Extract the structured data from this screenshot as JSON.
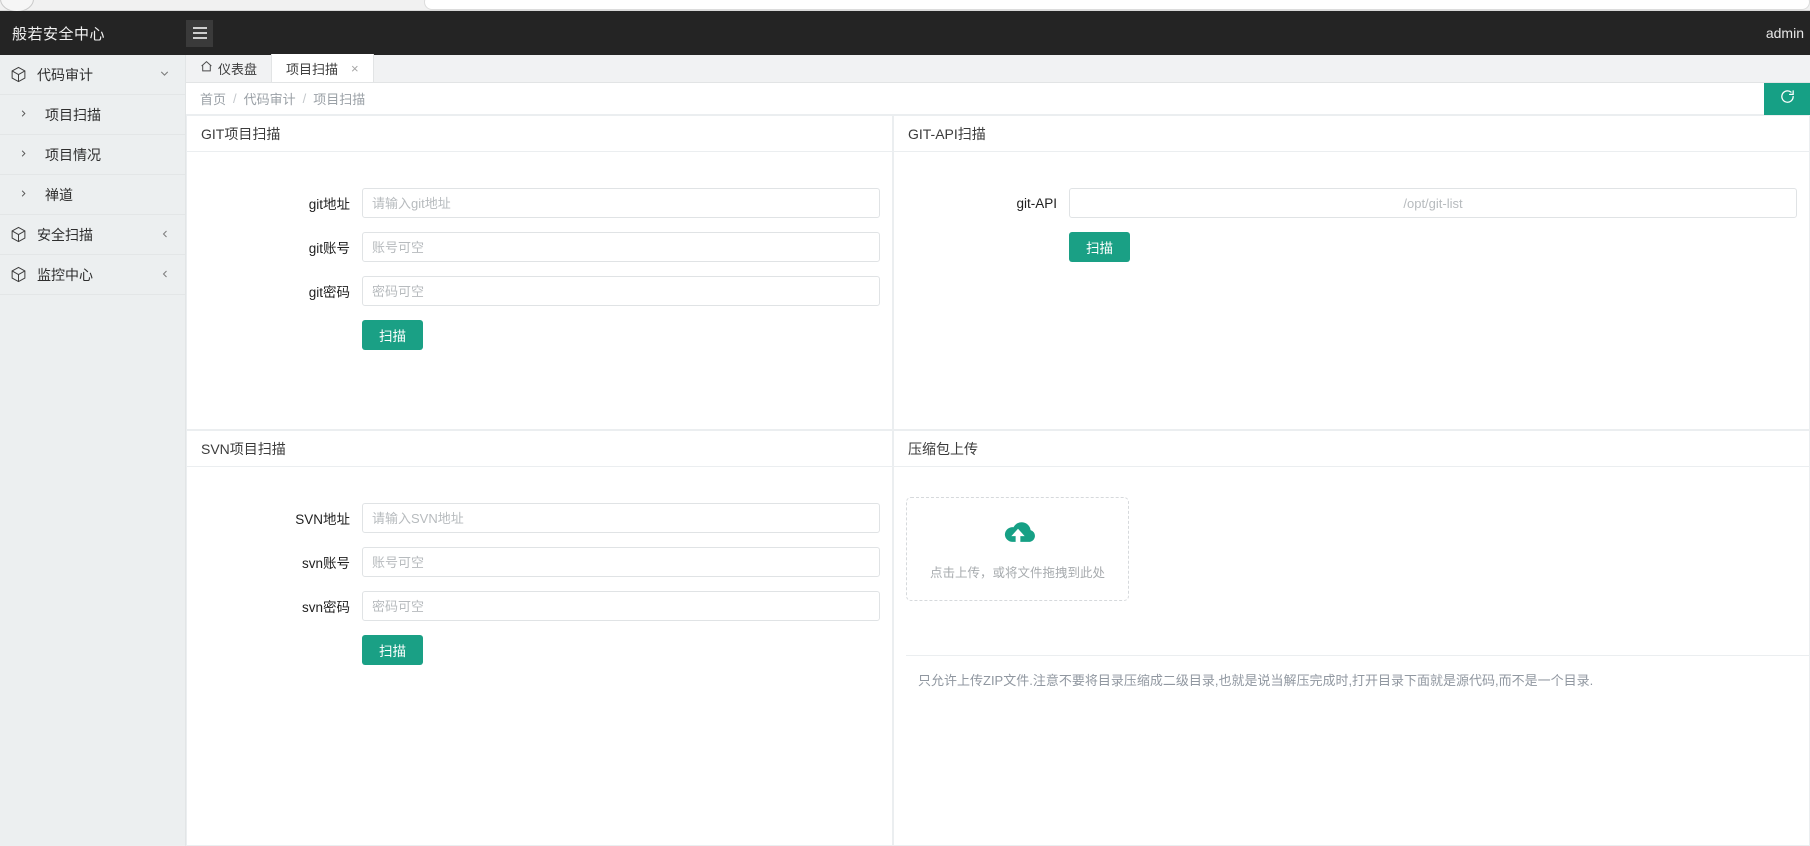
{
  "browser": {
    "omnibox_value": ""
  },
  "topbar": {
    "brand": "般若安全中心",
    "menu_toggle_name": "hamburger-menu",
    "user": "admin"
  },
  "sidebar": {
    "groups": [
      {
        "label": "代码审计",
        "icon": "cube-icon",
        "expanded": true,
        "chevron": "chevron-down-icon",
        "children": [
          {
            "label": "项目扫描",
            "chevron": "chevron-right-icon"
          },
          {
            "label": "项目情况",
            "chevron": "chevron-right-icon"
          },
          {
            "label": "禅道",
            "chevron": "chevron-right-icon"
          }
        ]
      },
      {
        "label": "安全扫描",
        "icon": "cube-icon",
        "expanded": false,
        "chevron": "chevron-left-icon",
        "children": []
      },
      {
        "label": "监控中心",
        "icon": "cube-icon",
        "expanded": false,
        "chevron": "chevron-left-icon",
        "children": []
      }
    ]
  },
  "tabs": [
    {
      "label": "仪表盘",
      "icon": "home-icon",
      "active": false,
      "closable": false
    },
    {
      "label": "项目扫描",
      "icon": "",
      "active": true,
      "closable": true,
      "close_glyph": "×"
    }
  ],
  "breadcrumb": {
    "items": [
      "首页",
      "代码审计",
      "项目扫描"
    ],
    "separator": "/",
    "refresh_icon": "refresh-icon"
  },
  "panels": {
    "git": {
      "title": "GIT项目扫描",
      "fields": [
        {
          "label": "git地址",
          "placeholder": "请输入git地址",
          "value": ""
        },
        {
          "label": "git账号",
          "placeholder": "账号可空",
          "value": ""
        },
        {
          "label": "git密码",
          "placeholder": "密码可空",
          "value": ""
        }
      ],
      "submit_label": "扫描"
    },
    "git_api": {
      "title": "GIT-API扫描",
      "fields": [
        {
          "label": "git-API",
          "placeholder": "/opt/git-list",
          "value": ""
        }
      ],
      "submit_label": "扫描"
    },
    "svn": {
      "title": "SVN项目扫描",
      "fields": [
        {
          "label": "SVN地址",
          "placeholder": "请输入SVN地址",
          "value": ""
        },
        {
          "label": "svn账号",
          "placeholder": "账号可空",
          "value": ""
        },
        {
          "label": "svn密码",
          "placeholder": "密码可空",
          "value": ""
        }
      ],
      "submit_label": "扫描"
    },
    "upload": {
      "title": "压缩包上传",
      "dropzone_text": "点击上传，或将文件拖拽到此处",
      "dropzone_icon": "cloud-upload-icon",
      "note": "只允许上传ZIP文件.注意不要将目录压缩成二级目录,也就是说当解压完成时,打开目录下面就是源代码,而不是一个目录."
    }
  },
  "colors": {
    "accent": "#1aa085",
    "topbar_bg": "#242424",
    "sidebar_bg": "#eceff0"
  }
}
